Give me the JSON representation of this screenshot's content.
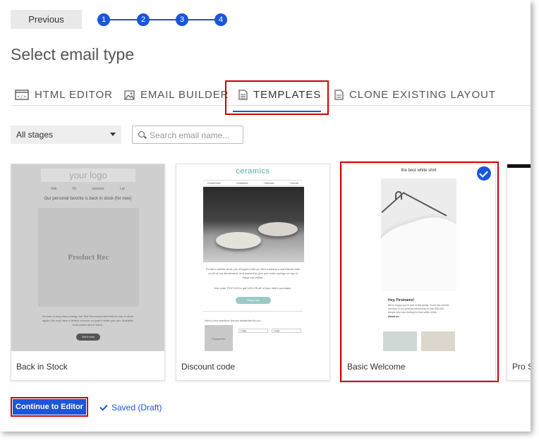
{
  "nav": {
    "previous_label": "Previous",
    "steps": [
      "1",
      "2",
      "3",
      "4"
    ]
  },
  "page_title": "Select email type",
  "tabs": [
    {
      "label": "HTML EDITOR",
      "icon": "code-window-icon",
      "active": false
    },
    {
      "label": "EMAIL BUILDER",
      "icon": "image-icon",
      "active": false
    },
    {
      "label": "TEMPLATES",
      "icon": "document-icon",
      "active": true
    },
    {
      "label": "CLONE EXISTING LAYOUT",
      "icon": "copy-document-icon",
      "active": false
    }
  ],
  "filters": {
    "stage_select": "All stages",
    "search_placeholder": "Search email name..."
  },
  "templates": [
    {
      "name": "Back in Stock",
      "preview": {
        "logo": "your logo",
        "nav": [
          "Info",
          "Hi",
          "xxxxxxx",
          "Lst"
        ],
        "headline": "Our personal favorite is back in stock (for now)",
        "product": "Product Rec",
        "body": "It's been a long time coming, but Tesl Recommended Item is now in stock again. We only have a limited amount, so grab it while you can. Available both online and in store.",
        "cta": "Get it now"
      }
    },
    {
      "name": "Discount code",
      "preview": {
        "brand": "ceramics",
        "nav": [
          "Households",
          "Drinkables",
          "Dishware",
          "Giocolli"
        ],
        "body": "It's been awhile since you shopped with us. We're having a warehouse sale on all of our dinnerware, and wanted to give you extra savings on top of these low prices.",
        "code_text": "Use code TEXT123 to get 10% Off off of your entire purchase.",
        "cta": "Shop now",
        "footer_text": "Here's a few selections that are handpicked for you.",
        "picked": [
          "Image",
          "Image"
        ],
        "product_label": "Product Rec"
      }
    },
    {
      "name": "Basic Welcome",
      "selected": true,
      "preview": {
        "title": "the best white shirt",
        "greeting": "Hey, Firstname!",
        "body": "We're happy you're part of this family. You're the newest member in our growing community of over 250,000 people who love finding the best white shirts.",
        "link": "About us ›"
      }
    },
    {
      "name": "Pro S",
      "partial": true
    }
  ],
  "footer": {
    "continue_label": "Continue to Editor",
    "saved_label": "Saved (Draft)"
  },
  "colors": {
    "accent": "#1a56db",
    "highlight": "#d00000"
  }
}
